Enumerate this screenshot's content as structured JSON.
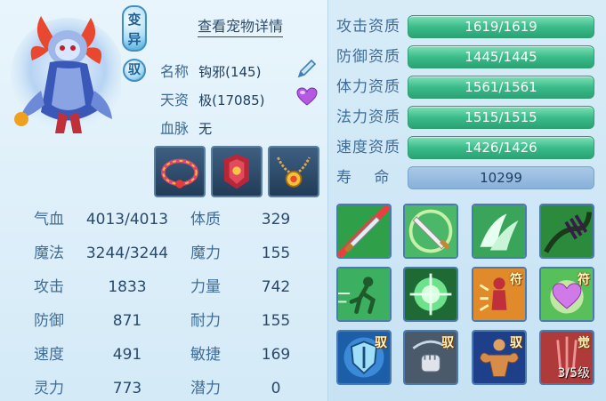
{
  "header": {
    "variant_badge": "变异",
    "tame_badge": "驭",
    "detail_link": "查看宠物详情"
  },
  "info": {
    "name_label": "名称",
    "name_value": "钩邪(145)",
    "talent_label": "天资",
    "talent_value": "极(17085)",
    "blood_label": "血脉",
    "blood_value": "无"
  },
  "icons": {
    "edit": "pen-icon",
    "heart": "heart-icon"
  },
  "equipment": [
    {
      "name": "ring-collar-equipment"
    },
    {
      "name": "red-armor-equipment"
    },
    {
      "name": "gem-necklace-equipment"
    }
  ],
  "attributes": [
    {
      "label": "气血",
      "value": "4013/4013",
      "label2": "体质",
      "value2": "329"
    },
    {
      "label": "魔法",
      "value": "3244/3244",
      "label2": "魔力",
      "value2": "155"
    },
    {
      "label": "攻击",
      "value": "1833",
      "label2": "力量",
      "value2": "742"
    },
    {
      "label": "防御",
      "value": "871",
      "label2": "耐力",
      "value2": "155"
    },
    {
      "label": "速度",
      "value": "491",
      "label2": "敏捷",
      "value2": "169"
    },
    {
      "label": "灵力",
      "value": "773",
      "label2": "潜力",
      "value2": "0"
    }
  ],
  "qualities": [
    {
      "label": "攻击资质",
      "value": "1619/1619",
      "fill": 1.0
    },
    {
      "label": "防御资质",
      "value": "1445/1445",
      "fill": 1.0
    },
    {
      "label": "体力资质",
      "value": "1561/1561",
      "fill": 1.0
    },
    {
      "label": "法力资质",
      "value": "1515/1515",
      "fill": 1.0
    },
    {
      "label": "速度资质",
      "value": "1426/1426",
      "fill": 1.0
    }
  ],
  "lifespan": {
    "label": "寿 命",
    "value": "10299"
  },
  "skills": [
    {
      "name": "sword-slash-skill",
      "tag": ""
    },
    {
      "name": "sword-strike-skill",
      "tag": ""
    },
    {
      "name": "wind-wings-skill",
      "tag": ""
    },
    {
      "name": "shadow-claw-skill",
      "tag": ""
    },
    {
      "name": "dash-runner-skill",
      "tag": ""
    },
    {
      "name": "green-orb-skill",
      "tag": ""
    },
    {
      "name": "fire-figure-skill",
      "tag": "符"
    },
    {
      "name": "heart-aura-skill",
      "tag": "符"
    },
    {
      "name": "shield-guard-skill",
      "tag": "驭"
    },
    {
      "name": "fist-strike-skill",
      "tag": "驭"
    },
    {
      "name": "muscle-power-skill",
      "tag": "驭"
    },
    {
      "name": "awakening-skill",
      "tag": "觉",
      "level": "3/5级"
    }
  ],
  "colors": {
    "quality_bar": "#3cbc8a",
    "life_bar": "#89b1da",
    "label_blue": "#3f6d98"
  }
}
